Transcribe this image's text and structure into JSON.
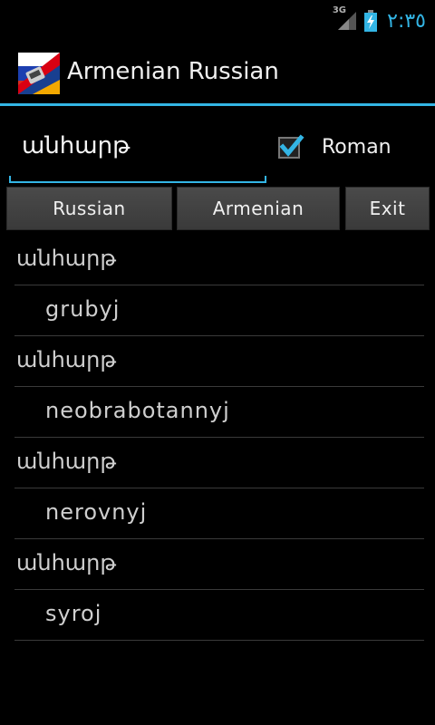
{
  "status": {
    "network": "3G",
    "time": "٢:٣٥",
    "accent": "#33b5e5"
  },
  "actionbar": {
    "title": "Armenian Russian",
    "icon": "armenia-russia-flag-icon"
  },
  "search": {
    "value": "անհարթ"
  },
  "roman": {
    "label": "Roman",
    "checked": true
  },
  "buttons": {
    "russian": "Russian",
    "armenian": "Armenian",
    "exit": "Exit"
  },
  "results": [
    {
      "word": "անհարթ",
      "translation": "grubyj"
    },
    {
      "word": "անհարթ",
      "translation": "neobrabotannyj"
    },
    {
      "word": "անհարթ",
      "translation": "nerovnyj"
    },
    {
      "word": "անհարթ",
      "translation": "syroj"
    }
  ]
}
